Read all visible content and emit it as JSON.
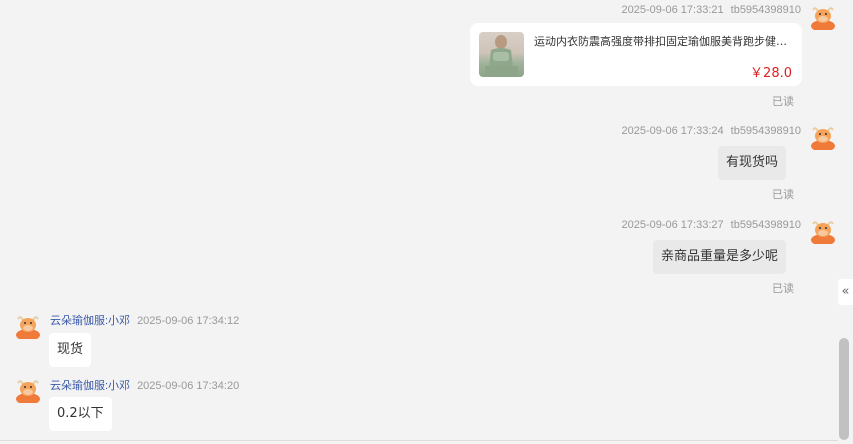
{
  "messages": [
    {
      "type": "product",
      "timestamp": "2025-09-06 17:33:21",
      "sender": "tb5954398910",
      "product_title": "运动内衣防震高强度带排扣固定瑜伽服美背跑步健身...",
      "price": "￥28.0",
      "read_status": "已读"
    },
    {
      "type": "text",
      "timestamp": "2025-09-06 17:33:24",
      "sender": "tb5954398910",
      "text": "有现货吗",
      "read_status": "已读"
    },
    {
      "type": "text",
      "timestamp": "2025-09-06 17:33:27",
      "sender": "tb5954398910",
      "text": "亲商品重量是多少呢",
      "read_status": "已读"
    },
    {
      "type": "text",
      "sender": "云朵瑜伽服:小邓",
      "timestamp": "2025-09-06 17:34:12",
      "text": "现货"
    },
    {
      "type": "text",
      "sender": "云朵瑜伽服:小邓",
      "timestamp": "2025-09-06 17:34:20",
      "text": "0.2以下"
    }
  ],
  "collapse_icon": "«",
  "colors": {
    "price": "#e02020",
    "seller_name": "#3a5aa8",
    "avatar": "#f07a3a"
  }
}
